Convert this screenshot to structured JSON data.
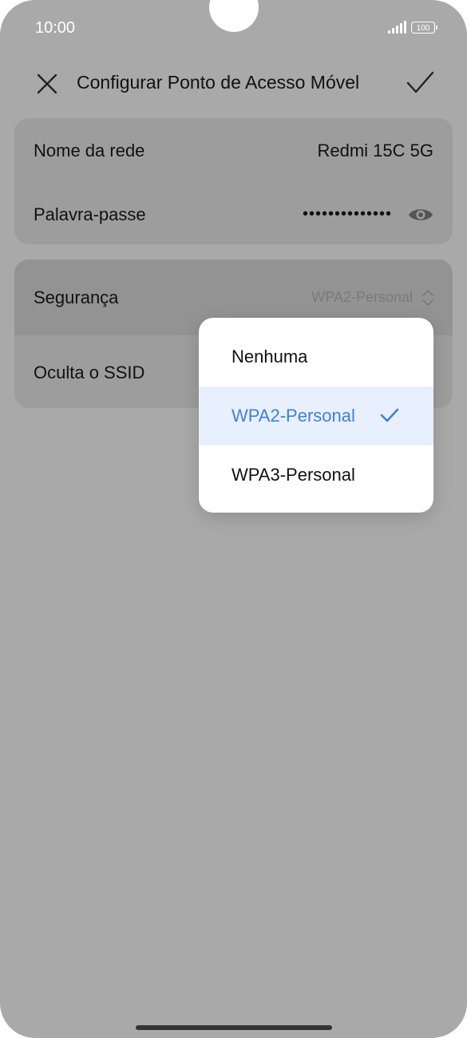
{
  "status_bar": {
    "time": "10:00",
    "battery": "100"
  },
  "topbar": {
    "title": "Configurar Ponto de Acesso Móvel",
    "close_icon": "close-icon",
    "confirm_icon": "checkmark-icon"
  },
  "network": {
    "name_label": "Nome da rede",
    "name_value": "Redmi 15C 5G",
    "password_label": "Palavra-passe",
    "password_value": "••••••••••••••",
    "visibility_icon": "eye-icon"
  },
  "security": {
    "label": "Segurança",
    "value": "WPA2-Personal",
    "hide_ssid_label": "Oculta o SSID"
  },
  "dropdown": {
    "options": [
      {
        "label": "Nenhuma",
        "selected": false
      },
      {
        "label": "WPA2-Personal",
        "selected": true
      },
      {
        "label": "WPA3-Personal",
        "selected": false
      }
    ]
  },
  "colors": {
    "accent": "#3f7fe0",
    "overlay": "#a9a9a9"
  }
}
